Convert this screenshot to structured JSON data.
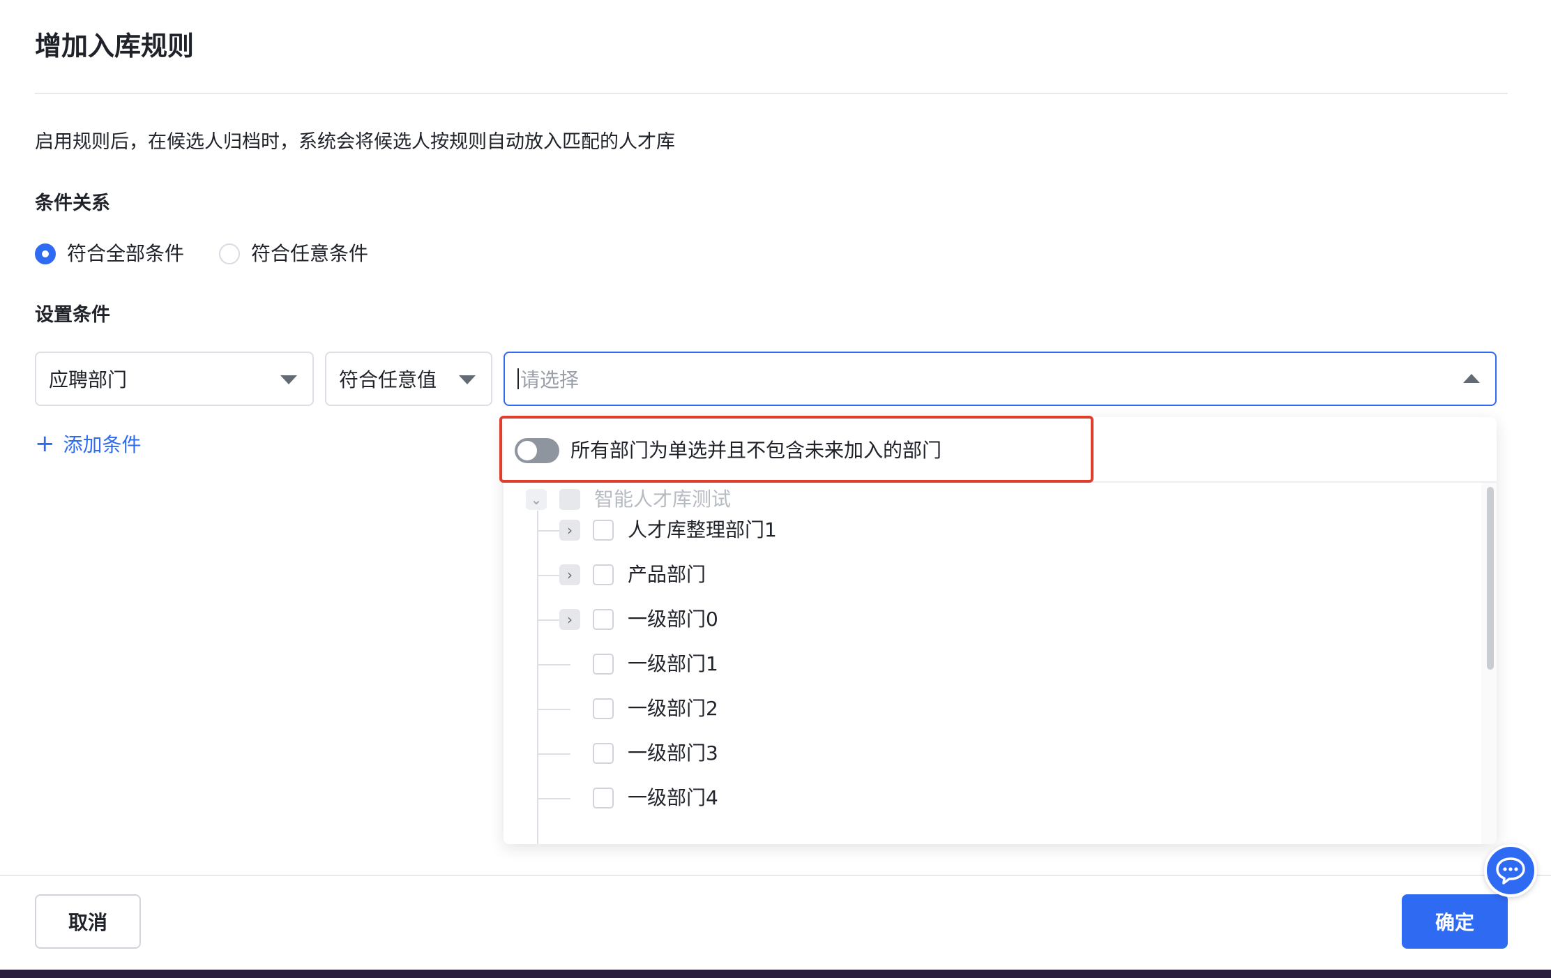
{
  "dialog": {
    "title": "增加入库规则",
    "description": "启用规则后，在候选人归档时，系统会将候选人按规则自动放入匹配的人才库"
  },
  "condition_relation": {
    "label": "条件关系",
    "options": [
      {
        "label": "符合全部条件",
        "checked": true
      },
      {
        "label": "符合任意条件",
        "checked": false
      }
    ]
  },
  "set_conditions": {
    "label": "设置条件",
    "field_select": {
      "value": "应聘部门"
    },
    "operator_select": {
      "value": "符合任意值"
    },
    "value_select": {
      "placeholder": "请选择"
    },
    "add_label": "添加条件",
    "add_icon": "+"
  },
  "dropdown": {
    "toggle": {
      "label": "所有部门为单选并且不包含未来加入的部门",
      "on": false
    },
    "root": {
      "label": "智能人才库测试",
      "expanded": true,
      "disabled": true
    },
    "children": [
      {
        "label": "人才库整理部门1",
        "has_children": true
      },
      {
        "label": "产品部门",
        "has_children": true
      },
      {
        "label": "一级部门0",
        "has_children": true
      },
      {
        "label": "一级部门1",
        "has_children": false
      },
      {
        "label": "一级部门2",
        "has_children": false
      },
      {
        "label": "一级部门3",
        "has_children": false
      },
      {
        "label": "一级部门4",
        "has_children": false
      }
    ]
  },
  "footer": {
    "cancel_label": "取消",
    "confirm_label": "确定"
  },
  "colors": {
    "accent": "#2f6af2",
    "highlight_border": "#e03e2d",
    "toggle_off": "#8f959e"
  },
  "icons": {
    "expand": "chevron-right-icon",
    "collapse": "chevron-down-icon",
    "chat": "chat-bubble-icon"
  }
}
